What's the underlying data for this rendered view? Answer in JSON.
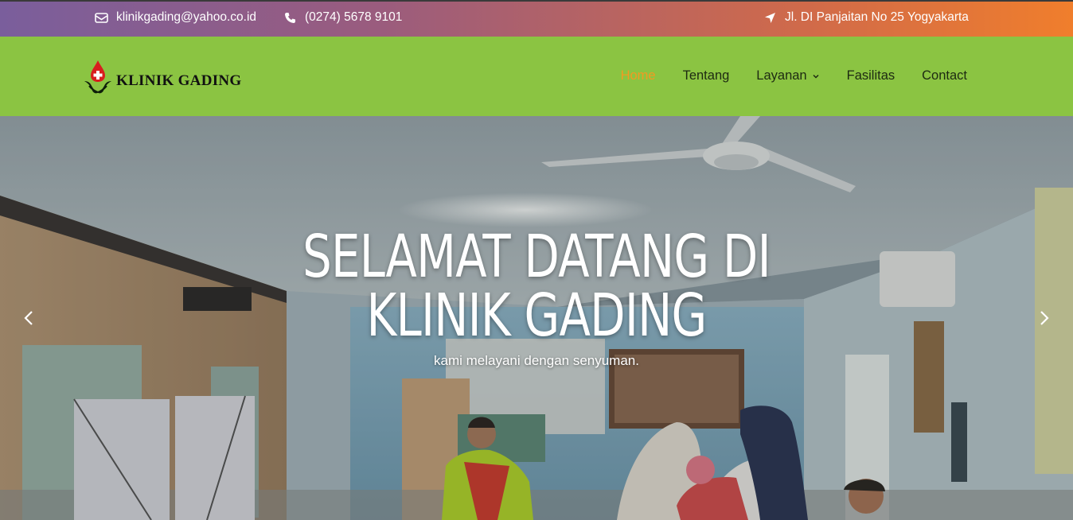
{
  "topbar": {
    "email": "klinikgading@yahoo.co.id",
    "phone": "(0274) 5678 9101",
    "address": "Jl. DI Panjaitan No 25 Yogyakarta",
    "icons": {
      "email": "envelope-icon",
      "phone": "phone-icon",
      "address": "location-arrow-icon"
    }
  },
  "brand": {
    "name": "KLINIK GADING"
  },
  "nav": {
    "items": [
      {
        "label": "Home",
        "active": true
      },
      {
        "label": "Tentang",
        "active": false
      },
      {
        "label": "Layanan",
        "active": false,
        "dropdown": true
      },
      {
        "label": "Fasilitas",
        "active": false
      },
      {
        "label": "Contact",
        "active": false
      }
    ]
  },
  "hero": {
    "title_line1": "SELAMAT DATANG DI",
    "title_line2": "KLINIK GADING",
    "subtitle": "kami melayani dengan senyuman."
  },
  "colors": {
    "nav_bg": "#8bc442",
    "active_link": "#f39a21",
    "topbar_gradient_start": "#7a5e9c",
    "topbar_gradient_end": "#f07e2c"
  }
}
